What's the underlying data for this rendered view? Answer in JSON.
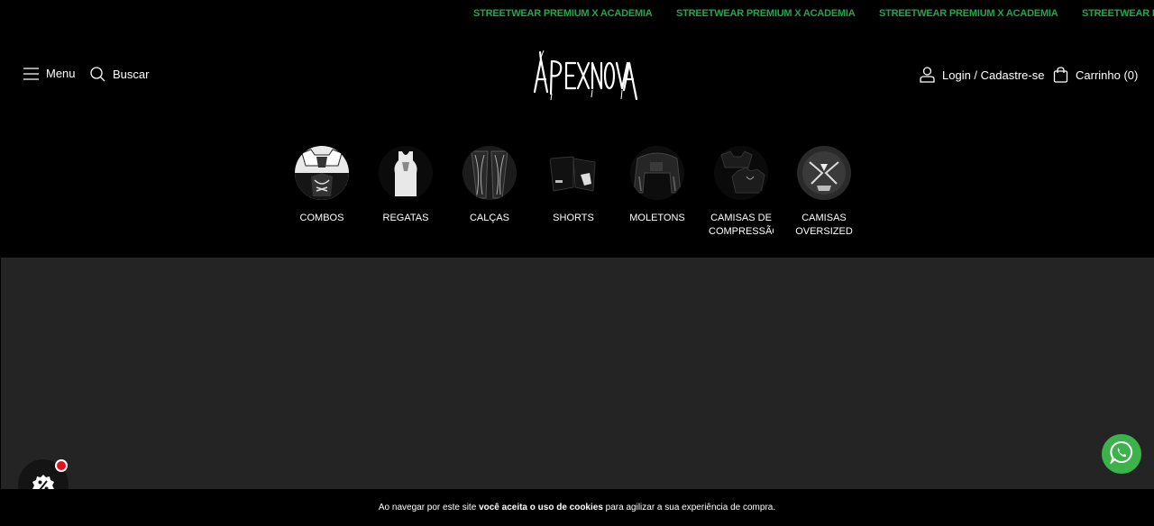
{
  "announcement": {
    "items": [
      "STREETWEAR PREMIUM X ACADEMIA",
      "STREETWEAR PREMIUM X ACADEMIA",
      "STREETWEAR PREMIUM X ACADEMIA",
      "STREETWEAR PREMIUM X ACADEMIA"
    ],
    "color": "#1fa84a"
  },
  "header": {
    "menu_label": "Menu",
    "search_label": "Buscar",
    "brand": "APEXNOVA",
    "login_label": "Login / Cadastre-se",
    "cart_label": "Carrinho (0)"
  },
  "categories": [
    {
      "label": "COMBOS"
    },
    {
      "label": "REGATAS"
    },
    {
      "label": "CALÇAS"
    },
    {
      "label": "SHORTS"
    },
    {
      "label": "MOLETONS"
    },
    {
      "label": "CAMISAS DE COMPRESSÃO"
    },
    {
      "label": "CAMISAS OVERSIZED"
    }
  ],
  "cookie": {
    "prefix": "Ao navegar por este site ",
    "bold": "você aceita o uso de cookies",
    "suffix": " para agilizar a sua experiência de compra."
  },
  "icons": {
    "menu": "menu-icon",
    "search": "search-icon",
    "user": "user-icon",
    "cart": "shopping-bag-icon",
    "whatsapp": "whatsapp-icon",
    "promo": "percent-badge-icon"
  },
  "colors": {
    "background": "#000000",
    "hero": "#242424",
    "accent_green": "#1fa84a",
    "whatsapp": "#3cb34a",
    "notification": "#e0141e"
  }
}
